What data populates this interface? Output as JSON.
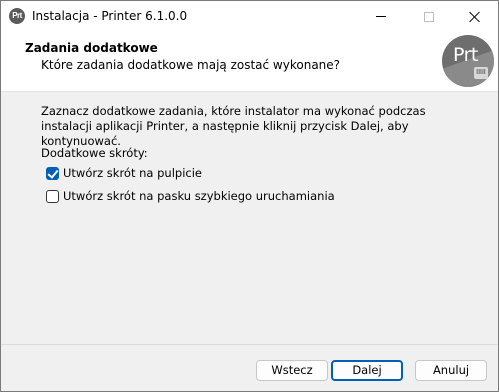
{
  "window": {
    "icon_text": "Prt",
    "title": "Instalacja - Printer 6.1.0.0"
  },
  "header": {
    "title": "Zadania dodatkowe",
    "subtitle": "Które zadania dodatkowe mają zostać wykonane?",
    "logo_text": "Prt",
    "logo_badge": "IIIII"
  },
  "content": {
    "instructions": "Zaznacz dodatkowe zadania, które instalator ma wykonać podczas instalacji aplikacji Printer, a następnie kliknij przycisk Dalej, aby kontynuować.",
    "section_label": "Dodatkowe skróty:",
    "options": [
      {
        "label": "Utwórz skrót na pulpicie",
        "checked": true
      },
      {
        "label": "Utwórz skrót na pasku szybkiego uruchamiania",
        "checked": false
      }
    ]
  },
  "buttons": {
    "back": "Wstecz",
    "next": "Dalej",
    "cancel": "Anuluj"
  },
  "colors": {
    "accent": "#005fb8",
    "header_bg": "#ffffff",
    "window_bg": "#f0f0f0"
  }
}
